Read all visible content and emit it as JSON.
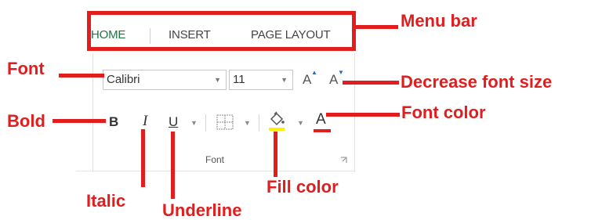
{
  "ribbon": {
    "tabs": [
      "HOME",
      "INSERT",
      "PAGE LAYOUT"
    ],
    "font_name": "Calibri",
    "font_size": "11",
    "grow_font_glyph": "A",
    "shrink_font_glyph": "A",
    "bold_glyph": "B",
    "italic_glyph": "I",
    "underline_glyph": "U",
    "font_color_glyph": "A",
    "group_label": "Font",
    "colors": {
      "home_tab": "#217346",
      "fill_highlight": "#ffef00",
      "font_color_bar": "#e11d1d"
    }
  },
  "annotations": {
    "menu_bar": "Menu bar",
    "font": "Font",
    "decrease_font_size": "Decrease font size",
    "bold": "Bold",
    "font_color": "Font color",
    "italic": "Italic",
    "fill_color": "Fill color",
    "underline": "Underline",
    "color": "#e11d1d"
  }
}
